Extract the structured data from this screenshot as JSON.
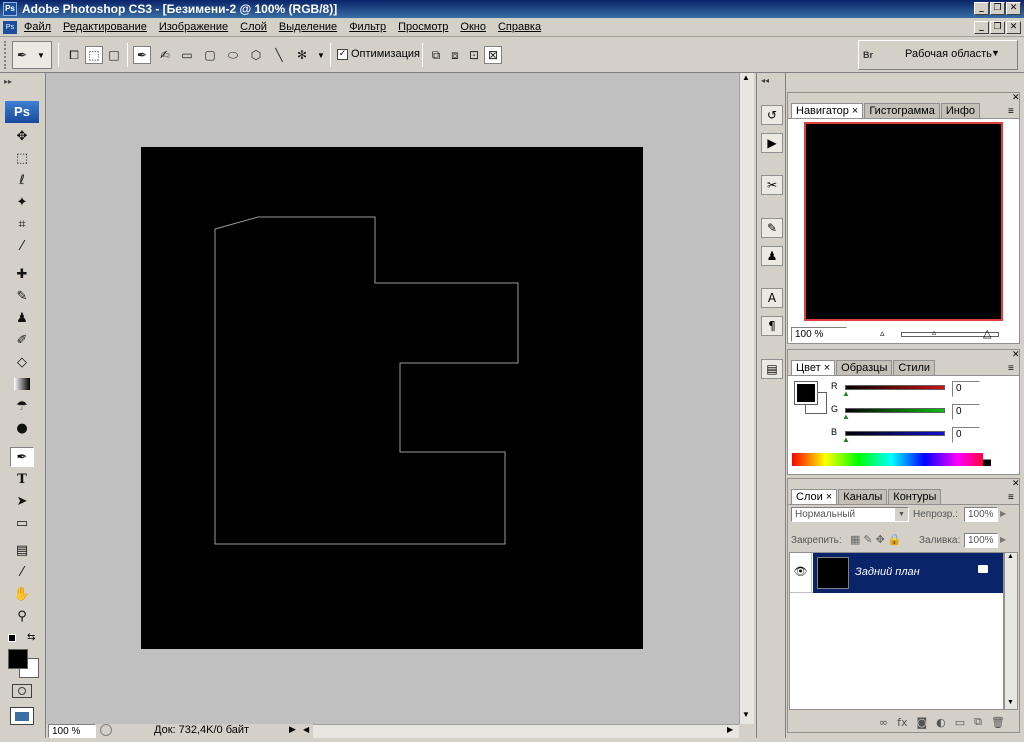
{
  "window": {
    "title": "Adobe Photoshop CS3 - [Безимени-2 @ 100% (RGB/8)]",
    "app_badge": "Ps"
  },
  "menu": [
    "Файл",
    "Редактирование",
    "Изображение",
    "Слой",
    "Выделение",
    "Фильтр",
    "Просмотр",
    "Окно",
    "Справка"
  ],
  "options": {
    "optimize_label": "Оптимизация",
    "optimize_checked": true,
    "workspace_label": "Рабочая область",
    "bridge_badge": "Br"
  },
  "toolbox": {
    "logo": "Ps",
    "tools": [
      "move-tool",
      "marquee-tool",
      "lasso-tool",
      "magic-wand-tool",
      "crop-tool",
      "eyedropper-tool",
      "healing-brush-tool",
      "brush-tool",
      "clone-stamp-tool",
      "history-brush-tool",
      "eraser-tool",
      "gradient-tool",
      "blur-tool",
      "dodge-tool",
      "pen-tool",
      "type-tool",
      "path-selection-tool",
      "rectangle-tool",
      "notes-tool",
      "eyedropper2-tool",
      "hand-tool",
      "zoom-tool"
    ],
    "active_tool": "pen-tool"
  },
  "status": {
    "zoom": "100 %",
    "doc_info": "Док: 732,4K/0 байт"
  },
  "navigator_panel": {
    "tabs": [
      "Навигатор",
      "Гистограмма",
      "Инфо"
    ],
    "zoom": "100 %"
  },
  "color_panel": {
    "tabs": [
      "Цвет",
      "Образцы",
      "Стили"
    ],
    "channels": [
      {
        "label": "R",
        "value": "0",
        "color": "#d01010"
      },
      {
        "label": "G",
        "value": "0",
        "color": "#10c010"
      },
      {
        "label": "B",
        "value": "0",
        "color": "#1010d0"
      }
    ]
  },
  "layers_panel": {
    "tabs": [
      "Слои",
      "Каналы",
      "Контуры"
    ],
    "blend_mode": "Нормальный",
    "opacity_label": "Непрозр.:",
    "opacity": "100%",
    "lock_label": "Закрепить:",
    "fill_label": "Заливка:",
    "fill": "100%",
    "layers": [
      {
        "name": "Задний план",
        "visible": true,
        "selected": true
      }
    ]
  },
  "colors": {
    "title_bar": "#0a246a",
    "layer_selected": "#0a246a",
    "canvas_bg": "#c0c0c0",
    "document": "#000000",
    "path_stroke": "#9a9a9a"
  }
}
